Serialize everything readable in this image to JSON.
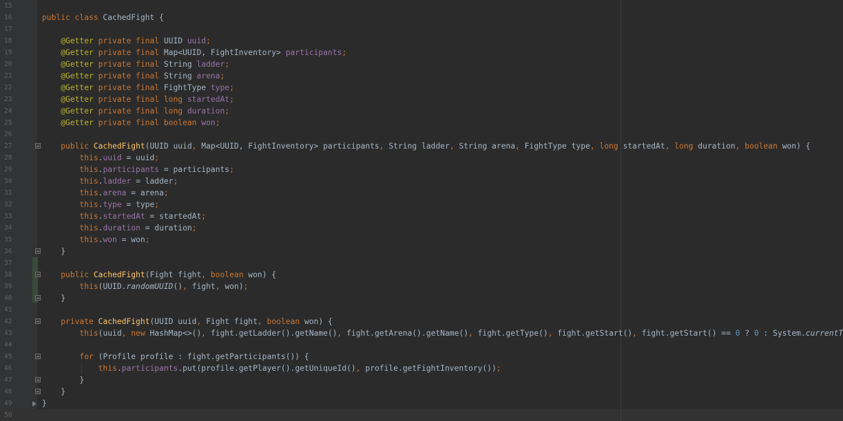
{
  "editor": {
    "lines": [
      {
        "num": "15",
        "tokens": []
      },
      {
        "num": "16",
        "tokens": [
          {
            "t": "public class ",
            "c": "kw"
          },
          {
            "t": "CachedFight {",
            "c": ""
          }
        ]
      },
      {
        "num": "17",
        "tokens": []
      },
      {
        "num": "18",
        "tokens": [
          {
            "t": "    ",
            "c": ""
          },
          {
            "t": "@Getter ",
            "c": "an"
          },
          {
            "t": "private final ",
            "c": "kw"
          },
          {
            "t": "UUID ",
            "c": ""
          },
          {
            "t": "uuid",
            "c": "fd"
          },
          {
            "t": ";",
            "c": "kw"
          }
        ]
      },
      {
        "num": "19",
        "tokens": [
          {
            "t": "    ",
            "c": ""
          },
          {
            "t": "@Getter ",
            "c": "an"
          },
          {
            "t": "private final ",
            "c": "kw"
          },
          {
            "t": "Map<UUID, FightInventory> ",
            "c": ""
          },
          {
            "t": "participants",
            "c": "fd"
          },
          {
            "t": ";",
            "c": "kw"
          }
        ]
      },
      {
        "num": "20",
        "tokens": [
          {
            "t": "    ",
            "c": ""
          },
          {
            "t": "@Getter ",
            "c": "an"
          },
          {
            "t": "private final ",
            "c": "kw"
          },
          {
            "t": "String ",
            "c": ""
          },
          {
            "t": "ladder",
            "c": "fd"
          },
          {
            "t": ";",
            "c": "kw"
          }
        ]
      },
      {
        "num": "21",
        "tokens": [
          {
            "t": "    ",
            "c": ""
          },
          {
            "t": "@Getter ",
            "c": "an"
          },
          {
            "t": "private final ",
            "c": "kw"
          },
          {
            "t": "String ",
            "c": ""
          },
          {
            "t": "arena",
            "c": "fd"
          },
          {
            "t": ";",
            "c": "kw"
          }
        ]
      },
      {
        "num": "22",
        "tokens": [
          {
            "t": "    ",
            "c": ""
          },
          {
            "t": "@Getter ",
            "c": "an"
          },
          {
            "t": "private final ",
            "c": "kw"
          },
          {
            "t": "FightType ",
            "c": ""
          },
          {
            "t": "type",
            "c": "fd"
          },
          {
            "t": ";",
            "c": "kw"
          }
        ]
      },
      {
        "num": "23",
        "tokens": [
          {
            "t": "    ",
            "c": ""
          },
          {
            "t": "@Getter ",
            "c": "an"
          },
          {
            "t": "private final long ",
            "c": "kw"
          },
          {
            "t": "startedAt",
            "c": "fd"
          },
          {
            "t": ";",
            "c": "kw"
          }
        ]
      },
      {
        "num": "24",
        "tokens": [
          {
            "t": "    ",
            "c": ""
          },
          {
            "t": "@Getter ",
            "c": "an"
          },
          {
            "t": "private final long ",
            "c": "kw"
          },
          {
            "t": "duration",
            "c": "fd"
          },
          {
            "t": ";",
            "c": "kw"
          }
        ]
      },
      {
        "num": "25",
        "tokens": [
          {
            "t": "    ",
            "c": ""
          },
          {
            "t": "@Getter ",
            "c": "an"
          },
          {
            "t": "private final boolean ",
            "c": "kw"
          },
          {
            "t": "won",
            "c": "fd"
          },
          {
            "t": ";",
            "c": "kw"
          }
        ]
      },
      {
        "num": "26",
        "tokens": []
      },
      {
        "num": "27",
        "fold": "start",
        "tokens": [
          {
            "t": "    ",
            "c": ""
          },
          {
            "t": "public ",
            "c": "kw"
          },
          {
            "t": "CachedFight",
            "c": "fn"
          },
          {
            "t": "(UUID uuid",
            "c": ""
          },
          {
            "t": ", ",
            "c": "kw"
          },
          {
            "t": "Map<UUID, FightInventory> participants",
            "c": ""
          },
          {
            "t": ", ",
            "c": "kw"
          },
          {
            "t": "String ladder",
            "c": ""
          },
          {
            "t": ", ",
            "c": "kw"
          },
          {
            "t": "String arena",
            "c": ""
          },
          {
            "t": ", ",
            "c": "kw"
          },
          {
            "t": "FightType type",
            "c": ""
          },
          {
            "t": ", long ",
            "c": "kw"
          },
          {
            "t": "startedAt",
            "c": ""
          },
          {
            "t": ", long ",
            "c": "kw"
          },
          {
            "t": "duration",
            "c": ""
          },
          {
            "t": ", boolean ",
            "c": "kw"
          },
          {
            "t": "won) {",
            "c": ""
          }
        ]
      },
      {
        "num": "28",
        "tokens": [
          {
            "t": "        ",
            "c": ""
          },
          {
            "t": "this",
            "c": "kw"
          },
          {
            "t": ".",
            "c": ""
          },
          {
            "t": "uuid",
            "c": "fd"
          },
          {
            "t": " = uuid",
            "c": ""
          },
          {
            "t": ";",
            "c": "kw"
          }
        ]
      },
      {
        "num": "29",
        "tokens": [
          {
            "t": "        ",
            "c": ""
          },
          {
            "t": "this",
            "c": "kw"
          },
          {
            "t": ".",
            "c": ""
          },
          {
            "t": "participants",
            "c": "fd"
          },
          {
            "t": " = participants",
            "c": ""
          },
          {
            "t": ";",
            "c": "kw"
          }
        ]
      },
      {
        "num": "30",
        "tokens": [
          {
            "t": "        ",
            "c": ""
          },
          {
            "t": "this",
            "c": "kw"
          },
          {
            "t": ".",
            "c": ""
          },
          {
            "t": "ladder",
            "c": "fd"
          },
          {
            "t": " = ladder",
            "c": ""
          },
          {
            "t": ";",
            "c": "kw"
          }
        ]
      },
      {
        "num": "31",
        "tokens": [
          {
            "t": "        ",
            "c": ""
          },
          {
            "t": "this",
            "c": "kw"
          },
          {
            "t": ".",
            "c": ""
          },
          {
            "t": "arena",
            "c": "fd"
          },
          {
            "t": " = arena",
            "c": ""
          },
          {
            "t": ";",
            "c": "kw"
          }
        ]
      },
      {
        "num": "32",
        "tokens": [
          {
            "t": "        ",
            "c": ""
          },
          {
            "t": "this",
            "c": "kw"
          },
          {
            "t": ".",
            "c": ""
          },
          {
            "t": "type",
            "c": "fd"
          },
          {
            "t": " = type",
            "c": ""
          },
          {
            "t": ";",
            "c": "kw"
          }
        ]
      },
      {
        "num": "33",
        "tokens": [
          {
            "t": "        ",
            "c": ""
          },
          {
            "t": "this",
            "c": "kw"
          },
          {
            "t": ".",
            "c": ""
          },
          {
            "t": "startedAt",
            "c": "fd"
          },
          {
            "t": " = startedAt",
            "c": ""
          },
          {
            "t": ";",
            "c": "kw"
          }
        ]
      },
      {
        "num": "34",
        "tokens": [
          {
            "t": "        ",
            "c": ""
          },
          {
            "t": "this",
            "c": "kw"
          },
          {
            "t": ".",
            "c": ""
          },
          {
            "t": "duration",
            "c": "fd"
          },
          {
            "t": " = duration",
            "c": ""
          },
          {
            "t": ";",
            "c": "kw"
          }
        ]
      },
      {
        "num": "35",
        "tokens": [
          {
            "t": "        ",
            "c": ""
          },
          {
            "t": "this",
            "c": "kw"
          },
          {
            "t": ".",
            "c": ""
          },
          {
            "t": "won",
            "c": "fd"
          },
          {
            "t": " = won",
            "c": ""
          },
          {
            "t": ";",
            "c": "kw"
          }
        ]
      },
      {
        "num": "36",
        "fold": "end",
        "tokens": [
          {
            "t": "    }",
            "c": ""
          }
        ]
      },
      {
        "num": "37",
        "tokens": []
      },
      {
        "num": "38",
        "fold": "start",
        "tokens": [
          {
            "t": "    ",
            "c": ""
          },
          {
            "t": "public ",
            "c": "kw"
          },
          {
            "t": "CachedFight",
            "c": "fn"
          },
          {
            "t": "(Fight fight",
            "c": ""
          },
          {
            "t": ", boolean ",
            "c": "kw"
          },
          {
            "t": "won) {",
            "c": ""
          }
        ]
      },
      {
        "num": "39",
        "tokens": [
          {
            "t": "        ",
            "c": ""
          },
          {
            "t": "this",
            "c": "kw"
          },
          {
            "t": "(UUID.",
            "c": ""
          },
          {
            "t": "randomUUID",
            "c": "it"
          },
          {
            "t": "()",
            "c": ""
          },
          {
            "t": ", ",
            "c": "kw"
          },
          {
            "t": "fight",
            "c": ""
          },
          {
            "t": ", ",
            "c": "kw"
          },
          {
            "t": "won)",
            "c": ""
          },
          {
            "t": ";",
            "c": "kw"
          }
        ]
      },
      {
        "num": "40",
        "fold": "end",
        "tokens": [
          {
            "t": "    }",
            "c": ""
          }
        ]
      },
      {
        "num": "41",
        "tokens": []
      },
      {
        "num": "42",
        "fold": "start",
        "tokens": [
          {
            "t": "    ",
            "c": ""
          },
          {
            "t": "private ",
            "c": "kw"
          },
          {
            "t": "CachedFight",
            "c": "fn"
          },
          {
            "t": "(UUID uuid",
            "c": ""
          },
          {
            "t": ", ",
            "c": "kw"
          },
          {
            "t": "Fight fight",
            "c": ""
          },
          {
            "t": ", boolean ",
            "c": "kw"
          },
          {
            "t": "won) {",
            "c": ""
          }
        ]
      },
      {
        "num": "43",
        "tokens": [
          {
            "t": "        ",
            "c": ""
          },
          {
            "t": "this",
            "c": "kw"
          },
          {
            "t": "(uuid",
            "c": ""
          },
          {
            "t": ", new ",
            "c": "kw"
          },
          {
            "t": "HashMap<>()",
            "c": ""
          },
          {
            "t": ", ",
            "c": "kw"
          },
          {
            "t": "fight.getLadder().getName()",
            "c": ""
          },
          {
            "t": ", ",
            "c": "kw"
          },
          {
            "t": "fight.getArena().getName()",
            "c": ""
          },
          {
            "t": ", ",
            "c": "kw"
          },
          {
            "t": "fight.getType()",
            "c": ""
          },
          {
            "t": ", ",
            "c": "kw"
          },
          {
            "t": "fight.getStart()",
            "c": ""
          },
          {
            "t": ", ",
            "c": "kw"
          },
          {
            "t": "fight.getStart() == ",
            "c": ""
          },
          {
            "t": "0",
            "c": "nm"
          },
          {
            "t": " ? ",
            "c": ""
          },
          {
            "t": "0",
            "c": "nm"
          },
          {
            "t": " : System.",
            "c": ""
          },
          {
            "t": "currentTimeMillis",
            "c": "it"
          }
        ]
      },
      {
        "num": "44",
        "tokens": []
      },
      {
        "num": "45",
        "fold": "start",
        "tokens": [
          {
            "t": "        ",
            "c": ""
          },
          {
            "t": "for ",
            "c": "kw"
          },
          {
            "t": "(Profile profile : fight.getParticipants()) {",
            "c": ""
          }
        ]
      },
      {
        "num": "46",
        "tokens": [
          {
            "t": "            ",
            "c": ""
          },
          {
            "t": "this",
            "c": "kw"
          },
          {
            "t": ".",
            "c": ""
          },
          {
            "t": "participants",
            "c": "fd"
          },
          {
            "t": ".put(profile.getPlayer().getUniqueId()",
            "c": ""
          },
          {
            "t": ", ",
            "c": "kw"
          },
          {
            "t": "profile.getFightInventory())",
            "c": ""
          },
          {
            "t": ";",
            "c": "kw"
          }
        ]
      },
      {
        "num": "47",
        "fold": "end",
        "tokens": [
          {
            "t": "        }",
            "c": ""
          }
        ]
      },
      {
        "num": "48",
        "fold": "end",
        "tokens": [
          {
            "t": "    }",
            "c": ""
          }
        ]
      },
      {
        "num": "49",
        "fold": "arrow",
        "tokens": [
          {
            "t": "}",
            "c": ""
          }
        ]
      },
      {
        "num": "50",
        "tokens": []
      }
    ]
  },
  "colors": {
    "background": "#2b2b2b",
    "gutter": "#313335",
    "keyword": "#cc7832",
    "annotation": "#bbb529",
    "field": "#9876aa",
    "method_decl": "#ffc66d",
    "number": "#6897bb",
    "text": "#a9b7c6",
    "vcs_changed": "#384c38"
  }
}
